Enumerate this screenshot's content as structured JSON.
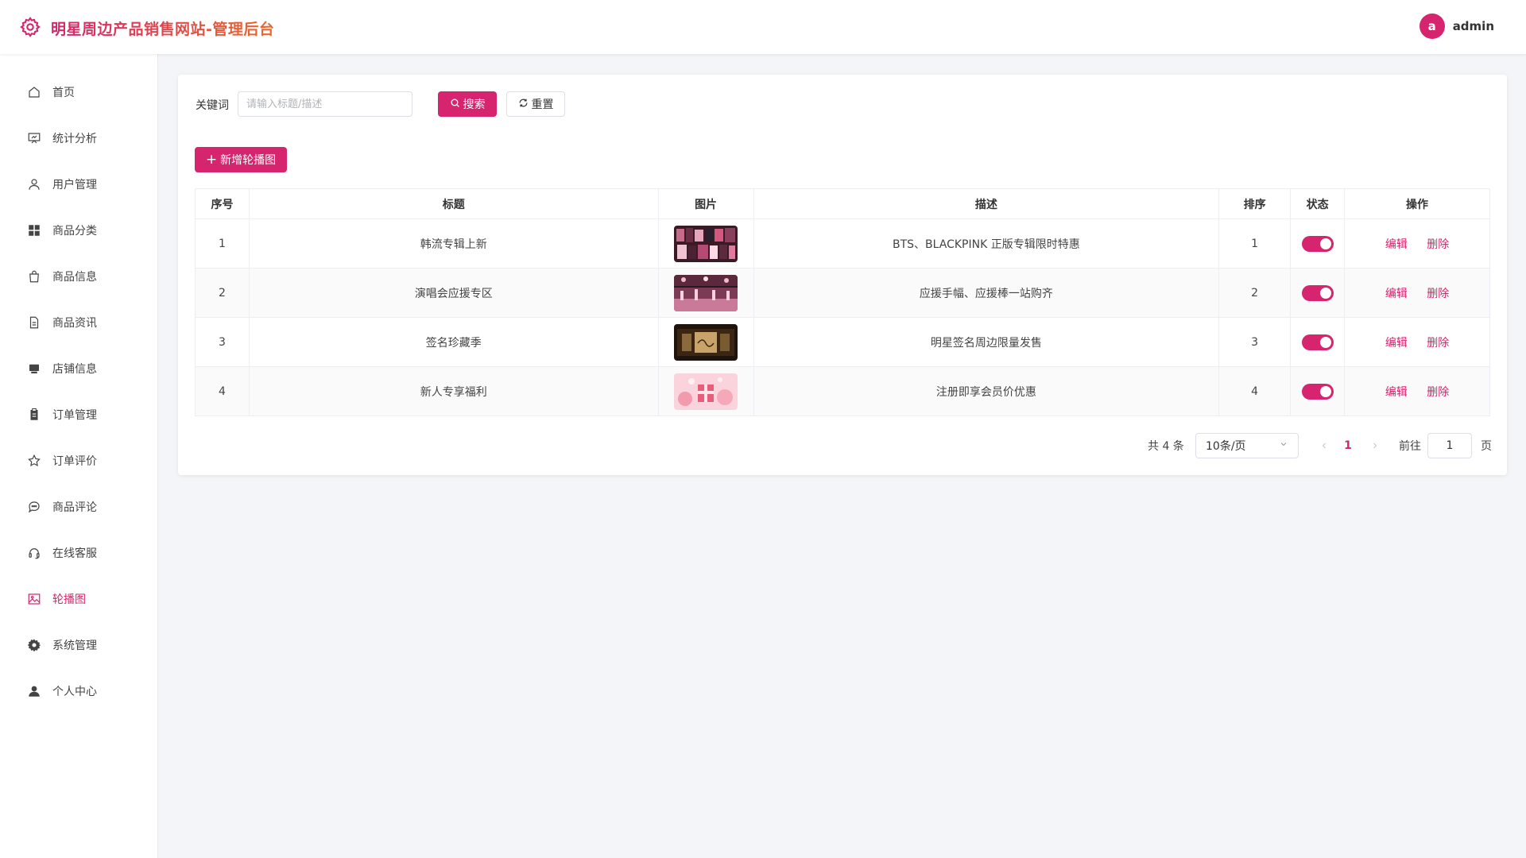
{
  "header": {
    "title": "明星周边产品销售网站-管理后台",
    "avatar_letter": "a",
    "username": "admin"
  },
  "sidebar": {
    "items": [
      {
        "label": "首页",
        "icon": "home-icon"
      },
      {
        "label": "统计分析",
        "icon": "chart-board-icon"
      },
      {
        "label": "用户管理",
        "icon": "user-icon"
      },
      {
        "label": "商品分类",
        "icon": "grid-icon"
      },
      {
        "label": "商品信息",
        "icon": "bag-icon"
      },
      {
        "label": "商品资讯",
        "icon": "document-icon"
      },
      {
        "label": "店铺信息",
        "icon": "shop-icon"
      },
      {
        "label": "订单管理",
        "icon": "clipboard-icon"
      },
      {
        "label": "订单评价",
        "icon": "star-icon"
      },
      {
        "label": "商品评论",
        "icon": "comment-icon"
      },
      {
        "label": "在线客服",
        "icon": "headset-icon"
      },
      {
        "label": "轮播图",
        "icon": "image-icon"
      },
      {
        "label": "系统管理",
        "icon": "gear-icon"
      },
      {
        "label": "个人中心",
        "icon": "person-icon"
      }
    ],
    "active_label": "轮播图"
  },
  "search": {
    "label": "关键词",
    "placeholder": "请输入标题/描述",
    "value": "",
    "search_button": "搜索",
    "reset_button": "重置"
  },
  "toolbar": {
    "add_button": "新增轮播图"
  },
  "table": {
    "headers": [
      "序号",
      "标题",
      "图片",
      "描述",
      "排序",
      "状态",
      "操作"
    ],
    "rows": [
      {
        "index": "1",
        "title": "韩流专辑上新",
        "image": "album-wall-thumbnail",
        "desc": "BTS、BLACKPINK 正版专辑限时特惠",
        "sort": "1",
        "status": "on"
      },
      {
        "index": "2",
        "title": "演唱会应援专区",
        "image": "concert-stage-thumbnail",
        "desc": "应援手幅、应援棒一站购齐",
        "sort": "2",
        "status": "on"
      },
      {
        "index": "3",
        "title": "签名珍藏季",
        "image": "signed-collection-thumbnail",
        "desc": "明星签名周边限量发售",
        "sort": "3",
        "status": "on"
      },
      {
        "index": "4",
        "title": "新人专享福利",
        "image": "pink-gift-thumbnail",
        "desc": "注册即享会员价优惠",
        "sort": "4",
        "status": "on"
      }
    ],
    "edit_label": "编辑",
    "delete_label": "删除"
  },
  "pagination": {
    "total_text": "共 4 条",
    "page_size": "10条/页",
    "current_page": "1",
    "goto_label": "前往",
    "goto_value": "1",
    "page_suffix": "页"
  },
  "colors": {
    "accent": "#d6246e",
    "title_gradient_end": "#e8692a"
  }
}
